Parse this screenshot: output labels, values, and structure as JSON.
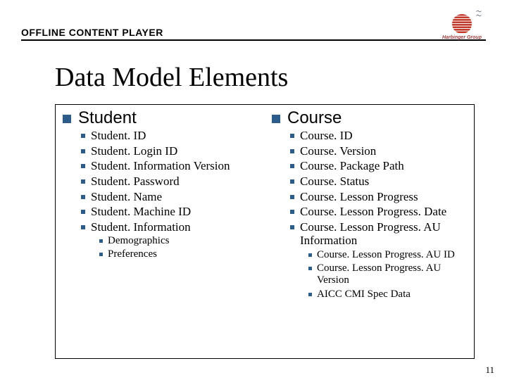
{
  "header": {
    "app_title": "OFFLINE CONTENT PLAYER",
    "logo_text": "Harbinger Group"
  },
  "slide": {
    "title": "Data Model Elements",
    "page_number": "11"
  },
  "left": {
    "heading": "Student",
    "items": [
      "Student. ID",
      "Student. Login ID",
      "Student. Information Version",
      "Student. Password",
      "Student. Name",
      "Student. Machine ID",
      "Student. Information"
    ],
    "subitems": [
      "Demographics",
      "Preferences"
    ]
  },
  "right": {
    "heading": "Course",
    "items": [
      "Course. ID",
      "Course. Version",
      "Course. Package Path",
      "Course. Status",
      "Course. Lesson Progress",
      "Course. Lesson Progress. Date",
      "Course. Lesson Progress. AU Information"
    ],
    "subitems": [
      "Course. Lesson Progress. AU ID",
      "Course. Lesson Progress. AU Version",
      "AICC CMI Spec Data"
    ]
  }
}
